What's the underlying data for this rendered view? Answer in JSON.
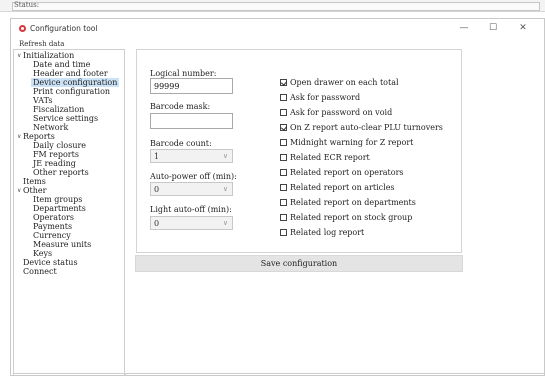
{
  "status_strip": {
    "label": "Status:"
  },
  "window": {
    "title": "Configuration tool",
    "controls": {
      "minimize": "—",
      "maximize": "☐",
      "close": "✕"
    }
  },
  "menu": {
    "refresh": "Refresh data"
  },
  "tree": {
    "initialization": "Initialization",
    "date_time": "Date and time",
    "header_footer": "Header and footer",
    "device_config": "Device configuration",
    "print_config": "Print configuration",
    "vats": "VATs",
    "fiscalization": "Fiscalization",
    "service_settings": "Service settings",
    "network": "Network",
    "reports": "Reports",
    "daily_closure": "Daily closure",
    "fm_reports": "FM reports",
    "je_reading": "JE reading",
    "other_reports": "Other reports",
    "items": "Items",
    "other": "Other",
    "item_groups": "Item groups",
    "departments": "Departments",
    "operators": "Operators",
    "payments": "Payments",
    "currency": "Currency",
    "measure_units": "Measure units",
    "keys": "Keys",
    "device_status": "Device status",
    "connect": "Connect"
  },
  "form": {
    "logical_number_label": "Logical number:",
    "logical_number_value": "99999",
    "barcode_mask_label": "Barcode mask:",
    "barcode_mask_value": "",
    "barcode_count_label": "Barcode count:",
    "barcode_count_value": "1",
    "auto_power_off_label": "Auto-power off (min):",
    "auto_power_off_value": "0",
    "light_auto_off_label": "Light auto-off (min):",
    "light_auto_off_value": "0"
  },
  "checks": [
    {
      "label": "Open drawer on each total",
      "checked": true
    },
    {
      "label": "Ask for password",
      "checked": false
    },
    {
      "label": "Ask for password on void",
      "checked": false
    },
    {
      "label": "On Z report auto-clear PLU turnovers",
      "checked": true
    },
    {
      "label": "Midnight warning for Z report",
      "checked": false
    },
    {
      "label": "Related ECR report",
      "checked": false
    },
    {
      "label": "Related report on operators",
      "checked": false
    },
    {
      "label": "Related report on articles",
      "checked": false
    },
    {
      "label": "Related report on departments",
      "checked": false
    },
    {
      "label": "Related report on stock group",
      "checked": false
    },
    {
      "label": "Related log report",
      "checked": false
    }
  ],
  "save_button": "Save configuration"
}
